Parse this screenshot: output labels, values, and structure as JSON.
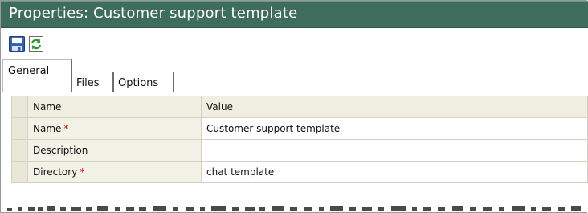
{
  "window": {
    "title": "Properties: Customer support template"
  },
  "toolbar": {
    "save": {
      "icon": "save-icon"
    },
    "refresh": {
      "icon": "refresh-icon"
    }
  },
  "tabs": [
    {
      "label": "General",
      "active": true
    },
    {
      "label": "Files",
      "active": false
    },
    {
      "label": "Options",
      "active": false
    }
  ],
  "properties": {
    "columns": [
      "Name",
      "Value"
    ],
    "rows": [
      {
        "name": "Name",
        "required": true,
        "value": "Customer support template"
      },
      {
        "name": "Description",
        "required": false,
        "value": ""
      },
      {
        "name": "Directory",
        "required": true,
        "value": "chat template"
      }
    ],
    "required_marker": "*"
  },
  "colors": {
    "title_bar": "#3f6d5d",
    "required": "#d40000",
    "row_header": "#e9e8d8",
    "name_cell": "#f3f2e7"
  }
}
